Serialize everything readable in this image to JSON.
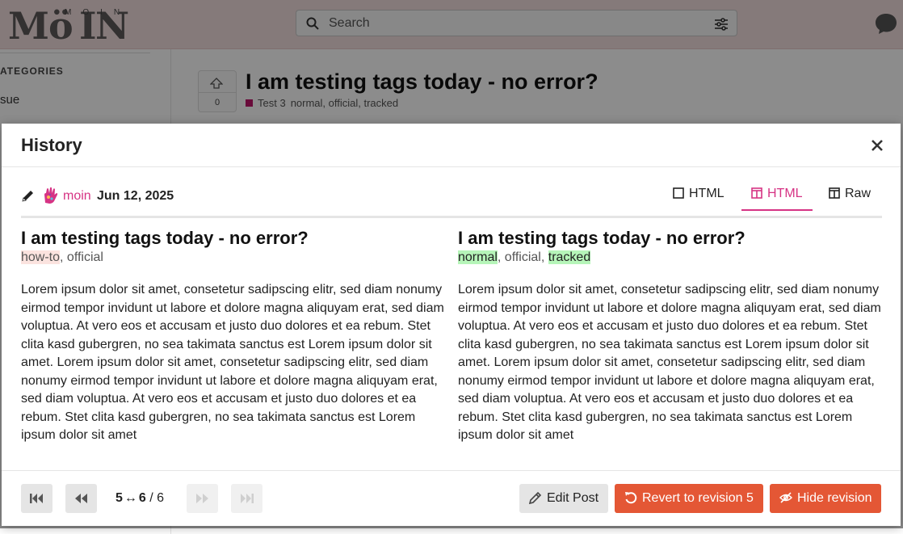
{
  "site": {
    "logo_text": "MOIN",
    "search_placeholder": "Search",
    "sidebar_heading": "ATEGORIES",
    "sidebar_item": "sue"
  },
  "topic": {
    "vote_count": "0",
    "title": "I am testing tags today - no error?",
    "category": "Test 3",
    "tags": "normal, official, tracked"
  },
  "modal": {
    "title": "History",
    "author": "moin",
    "date": "Jun 12, 2025",
    "tabs": {
      "inline": "HTML",
      "side_by_side": "HTML",
      "raw": "Raw"
    },
    "previous": {
      "title": "I am testing tags today - no error?",
      "tag_removed": "how-to",
      "tag_sep": ", ",
      "tag_kept": "official",
      "body": "Lorem ipsum dolor sit amet, consetetur sadipscing elitr, sed diam nonumy eirmod tempor invidunt ut labore et dolore magna aliquyam erat, sed diam voluptua. At vero eos et accusam et justo duo dolores et ea rebum. Stet clita kasd gubergren, no sea takimata sanctus est Lorem ipsum dolor sit amet. Lorem ipsum dolor sit amet, consetetur sadipscing elitr, sed diam nonumy eirmod tempor invidunt ut labore et dolore magna aliquyam erat, sed diam voluptua. At vero eos et accusam et justo duo dolores et ea rebum. Stet clita kasd gubergren, no sea takimata sanctus est Lorem ipsum dolor sit amet"
    },
    "current": {
      "title": "I am testing tags today - no error?",
      "tag_added_1": "normal",
      "tag_sep_1": ", official, ",
      "tag_added_2": "tracked",
      "body": "Lorem ipsum dolor sit amet, consetetur sadipscing elitr, sed diam nonumy eirmod tempor invidunt ut labore et dolore magna aliquyam erat, sed diam voluptua. At vero eos et accusam et justo duo dolores et ea rebum. Stet clita kasd gubergren, no sea takimata sanctus est Lorem ipsum dolor sit amet. Lorem ipsum dolor sit amet, consetetur sadipscing elitr, sed diam nonumy eirmod tempor invidunt ut labore et dolore magna aliquyam erat, sed diam voluptua. At vero eos et accusam et justo duo dolores et ea rebum. Stet clita kasd gubergren, no sea takimata sanctus est Lorem ipsum dolor sit amet"
    },
    "footer": {
      "rev_from": "5",
      "rev_to": "6",
      "rev_total": "/ 6",
      "edit_label": "Edit Post",
      "revert_label": "Revert to revision 5",
      "hide_label": "Hide revision"
    },
    "colors": {
      "accent": "#d63384",
      "danger": "#e45735",
      "insert_bg": "#b6f5b9",
      "delete_bg": "#fbe3df"
    }
  }
}
